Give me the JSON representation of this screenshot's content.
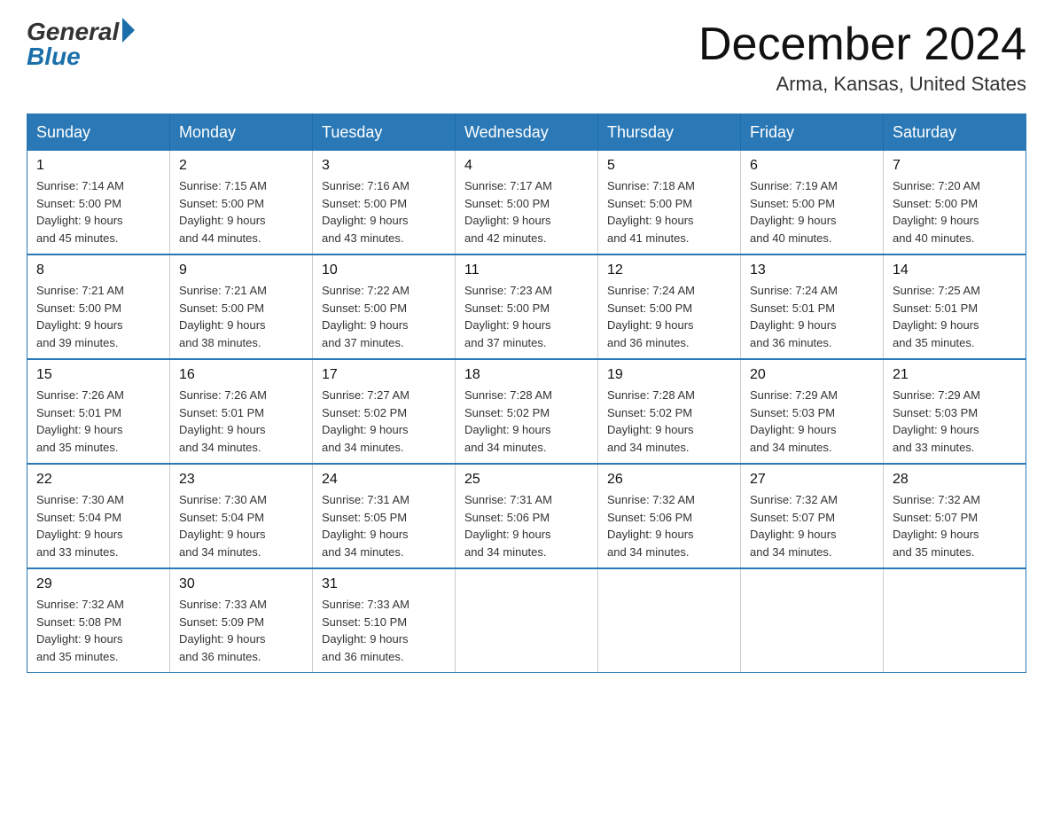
{
  "logo": {
    "general": "General",
    "blue": "Blue"
  },
  "title": {
    "month": "December 2024",
    "location": "Arma, Kansas, United States"
  },
  "weekdays": [
    "Sunday",
    "Monday",
    "Tuesday",
    "Wednesday",
    "Thursday",
    "Friday",
    "Saturday"
  ],
  "weeks": [
    [
      {
        "day": "1",
        "sunrise": "7:14 AM",
        "sunset": "5:00 PM",
        "daylight": "9 hours and 45 minutes."
      },
      {
        "day": "2",
        "sunrise": "7:15 AM",
        "sunset": "5:00 PM",
        "daylight": "9 hours and 44 minutes."
      },
      {
        "day": "3",
        "sunrise": "7:16 AM",
        "sunset": "5:00 PM",
        "daylight": "9 hours and 43 minutes."
      },
      {
        "day": "4",
        "sunrise": "7:17 AM",
        "sunset": "5:00 PM",
        "daylight": "9 hours and 42 minutes."
      },
      {
        "day": "5",
        "sunrise": "7:18 AM",
        "sunset": "5:00 PM",
        "daylight": "9 hours and 41 minutes."
      },
      {
        "day": "6",
        "sunrise": "7:19 AM",
        "sunset": "5:00 PM",
        "daylight": "9 hours and 40 minutes."
      },
      {
        "day": "7",
        "sunrise": "7:20 AM",
        "sunset": "5:00 PM",
        "daylight": "9 hours and 40 minutes."
      }
    ],
    [
      {
        "day": "8",
        "sunrise": "7:21 AM",
        "sunset": "5:00 PM",
        "daylight": "9 hours and 39 minutes."
      },
      {
        "day": "9",
        "sunrise": "7:21 AM",
        "sunset": "5:00 PM",
        "daylight": "9 hours and 38 minutes."
      },
      {
        "day": "10",
        "sunrise": "7:22 AM",
        "sunset": "5:00 PM",
        "daylight": "9 hours and 37 minutes."
      },
      {
        "day": "11",
        "sunrise": "7:23 AM",
        "sunset": "5:00 PM",
        "daylight": "9 hours and 37 minutes."
      },
      {
        "day": "12",
        "sunrise": "7:24 AM",
        "sunset": "5:00 PM",
        "daylight": "9 hours and 36 minutes."
      },
      {
        "day": "13",
        "sunrise": "7:24 AM",
        "sunset": "5:01 PM",
        "daylight": "9 hours and 36 minutes."
      },
      {
        "day": "14",
        "sunrise": "7:25 AM",
        "sunset": "5:01 PM",
        "daylight": "9 hours and 35 minutes."
      }
    ],
    [
      {
        "day": "15",
        "sunrise": "7:26 AM",
        "sunset": "5:01 PM",
        "daylight": "9 hours and 35 minutes."
      },
      {
        "day": "16",
        "sunrise": "7:26 AM",
        "sunset": "5:01 PM",
        "daylight": "9 hours and 34 minutes."
      },
      {
        "day": "17",
        "sunrise": "7:27 AM",
        "sunset": "5:02 PM",
        "daylight": "9 hours and 34 minutes."
      },
      {
        "day": "18",
        "sunrise": "7:28 AM",
        "sunset": "5:02 PM",
        "daylight": "9 hours and 34 minutes."
      },
      {
        "day": "19",
        "sunrise": "7:28 AM",
        "sunset": "5:02 PM",
        "daylight": "9 hours and 34 minutes."
      },
      {
        "day": "20",
        "sunrise": "7:29 AM",
        "sunset": "5:03 PM",
        "daylight": "9 hours and 34 minutes."
      },
      {
        "day": "21",
        "sunrise": "7:29 AM",
        "sunset": "5:03 PM",
        "daylight": "9 hours and 33 minutes."
      }
    ],
    [
      {
        "day": "22",
        "sunrise": "7:30 AM",
        "sunset": "5:04 PM",
        "daylight": "9 hours and 33 minutes."
      },
      {
        "day": "23",
        "sunrise": "7:30 AM",
        "sunset": "5:04 PM",
        "daylight": "9 hours and 34 minutes."
      },
      {
        "day": "24",
        "sunrise": "7:31 AM",
        "sunset": "5:05 PM",
        "daylight": "9 hours and 34 minutes."
      },
      {
        "day": "25",
        "sunrise": "7:31 AM",
        "sunset": "5:06 PM",
        "daylight": "9 hours and 34 minutes."
      },
      {
        "day": "26",
        "sunrise": "7:32 AM",
        "sunset": "5:06 PM",
        "daylight": "9 hours and 34 minutes."
      },
      {
        "day": "27",
        "sunrise": "7:32 AM",
        "sunset": "5:07 PM",
        "daylight": "9 hours and 34 minutes."
      },
      {
        "day": "28",
        "sunrise": "7:32 AM",
        "sunset": "5:07 PM",
        "daylight": "9 hours and 35 minutes."
      }
    ],
    [
      {
        "day": "29",
        "sunrise": "7:32 AM",
        "sunset": "5:08 PM",
        "daylight": "9 hours and 35 minutes."
      },
      {
        "day": "30",
        "sunrise": "7:33 AM",
        "sunset": "5:09 PM",
        "daylight": "9 hours and 36 minutes."
      },
      {
        "day": "31",
        "sunrise": "7:33 AM",
        "sunset": "5:10 PM",
        "daylight": "9 hours and 36 minutes."
      },
      null,
      null,
      null,
      null
    ]
  ]
}
